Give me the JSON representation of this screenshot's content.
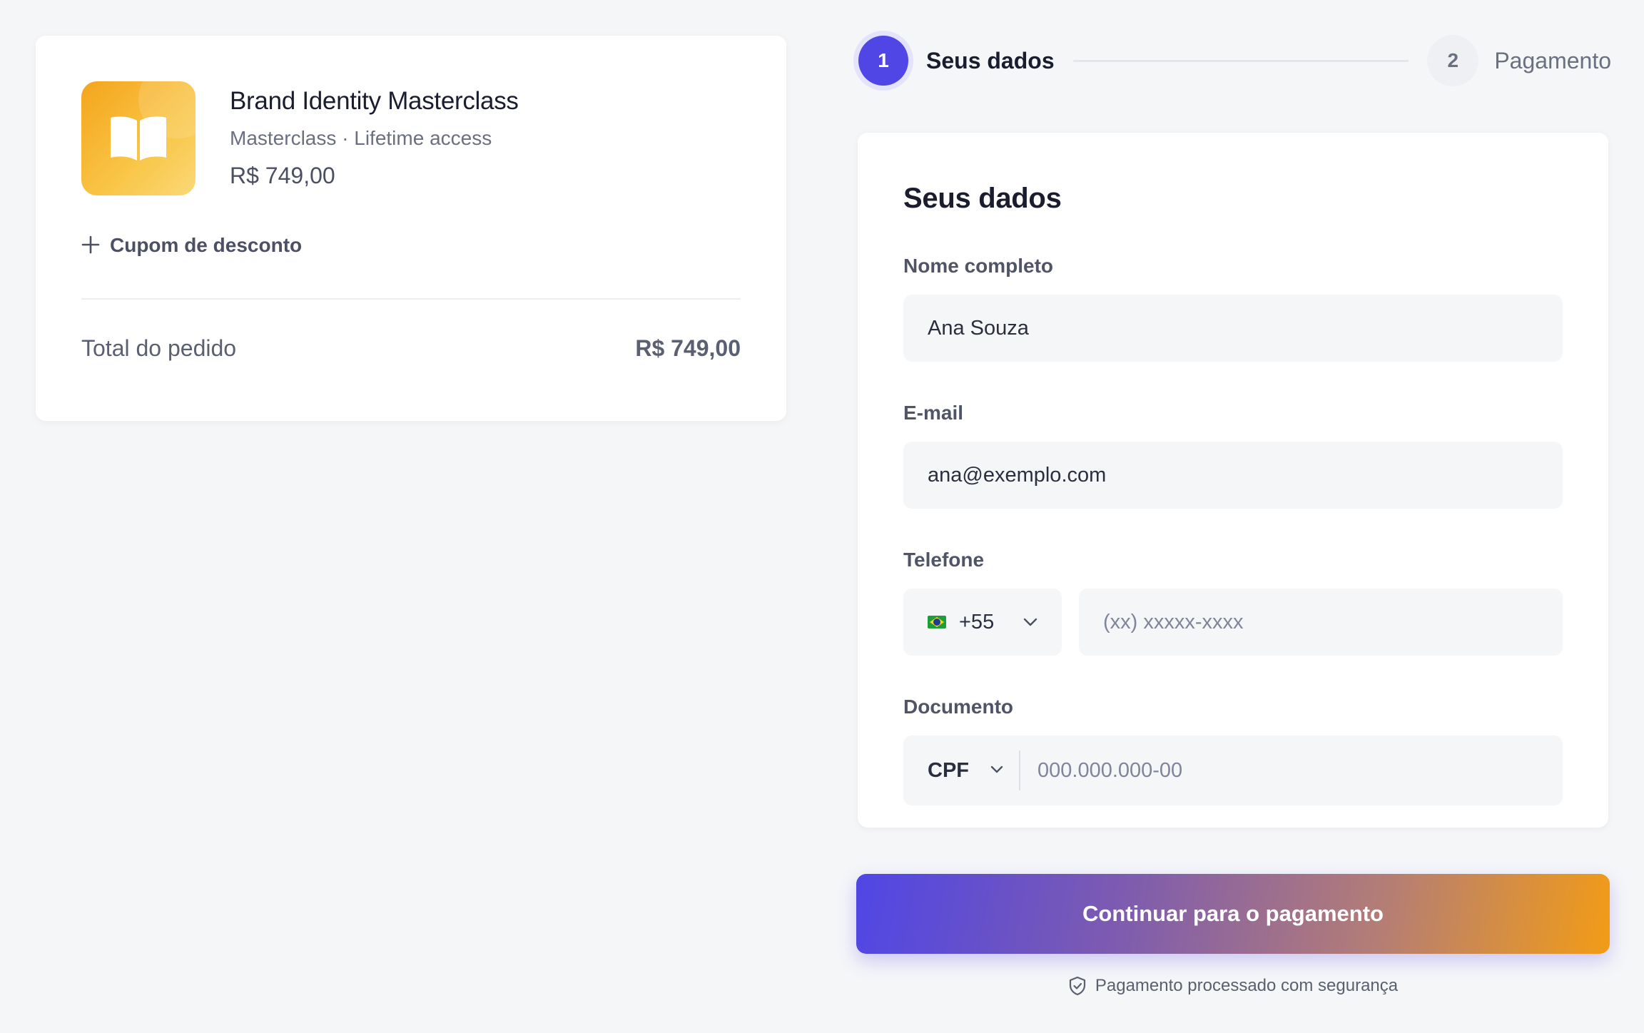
{
  "summary": {
    "product_title": "Brand Identity Masterclass",
    "product_subtitle": "Masterclass · Lifetime access",
    "product_price": "R$ 749,00",
    "product_icon": "open-book-icon",
    "coupon_icon": "plus-icon",
    "coupon_label": "Cupom de desconto",
    "total_label": "Total do pedido",
    "total_value": "R$ 749,00"
  },
  "stepper": {
    "steps": [
      {
        "number": "1",
        "label": "Seus dados",
        "active": true
      },
      {
        "number": "2",
        "label": "Pagamento",
        "active": false
      }
    ]
  },
  "form": {
    "title": "Seus dados",
    "name_label": "Nome completo",
    "name_value": "Ana Souza",
    "email_label": "E-mail",
    "email_value": "ana@exemplo.com",
    "phone_label": "Telefone",
    "phone_country_code": "+55",
    "phone_flag": "brazil-flag-icon",
    "phone_placeholder": "(xx) xxxxx-xxxx",
    "document_label": "Documento",
    "document_type": "CPF",
    "document_placeholder": "000.000.000-00"
  },
  "cta": {
    "label": "Continuar para o pagamento",
    "secure_icon": "shield-check-icon",
    "secure_note": "Pagamento processado com segurança"
  },
  "colors": {
    "accent": "#4f46e5",
    "gradient_end": "#f29c16",
    "thumb": "#f4a51c",
    "background": "#f5f6f8"
  }
}
